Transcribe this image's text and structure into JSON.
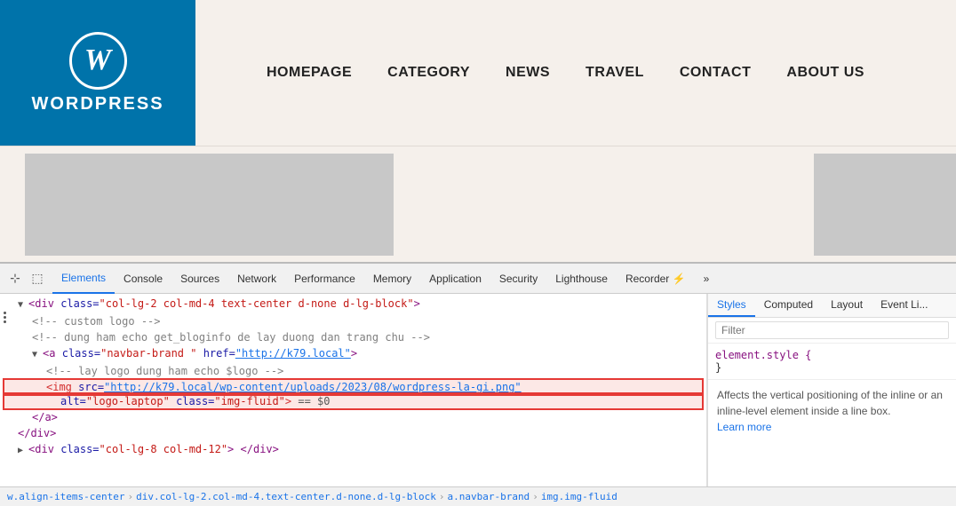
{
  "navbar": {
    "logo_text": "WORDPRESS",
    "links": [
      {
        "label": "HOMEPAGE",
        "id": "homepage"
      },
      {
        "label": "CATEGORY",
        "id": "category"
      },
      {
        "label": "NEWS",
        "id": "news"
      },
      {
        "label": "TRAVEL",
        "id": "travel"
      },
      {
        "label": "CONTACT",
        "id": "contact"
      },
      {
        "label": "ABOUT US",
        "id": "aboutus"
      }
    ]
  },
  "devtools": {
    "tabs": [
      {
        "label": "Elements",
        "active": true
      },
      {
        "label": "Console",
        "active": false
      },
      {
        "label": "Sources",
        "active": false
      },
      {
        "label": "Network",
        "active": false
      },
      {
        "label": "Performance",
        "active": false
      },
      {
        "label": "Memory",
        "active": false
      },
      {
        "label": "Application",
        "active": false
      },
      {
        "label": "Security",
        "active": false
      },
      {
        "label": "Lighthouse",
        "active": false
      },
      {
        "label": "Recorder ⚡",
        "active": false
      },
      {
        "label": "»",
        "active": false
      }
    ],
    "styles_tabs": [
      {
        "label": "Styles",
        "active": true
      },
      {
        "label": "Computed",
        "active": false
      },
      {
        "label": "Layout",
        "active": false
      },
      {
        "label": "Event Li...",
        "active": false
      }
    ],
    "filter_placeholder": "Filter",
    "element_style": "element.style {",
    "element_style_close": "}",
    "tooltip_text": "Affects the vertical positioning of the inline or an inline-level element inside a line box.",
    "learn_more_label": "Learn more"
  },
  "breadcrumb": {
    "items": [
      "w.align-items-center",
      "div.col-lg-2.col-md-4.text-center.d-none.d-lg-block",
      "a.navbar-brand",
      "img.img-fluid"
    ]
  },
  "code_lines": [
    {
      "indent": "indent1",
      "html": "▼ <span class='tag'>&lt;div</span> <span class='attr'>class=</span><span class='val'>\"col-lg-2 col-md-4 text-center d-none d-lg-block\"</span><span class='tag'>&gt;</span>"
    },
    {
      "indent": "indent2",
      "html": "<span class='comment'>&lt;!-- custom logo --&gt;</span>"
    },
    {
      "indent": "indent2",
      "html": "<span class='comment'>&lt;!-- dung ham echo get_bloginfo de lay duong dan trang chu --&gt;</span>"
    },
    {
      "indent": "indent2",
      "html": "<span class='arrow'>▼</span> <span class='tag'>&lt;a</span> <span class='attr'>class=</span><span class='val'>\"navbar-brand \"</span> <span class='attr'>href=</span><span class='link-val'>\"http://k79.local\"</span><span class='tag'>&gt;</span>"
    },
    {
      "indent": "indent3",
      "html": "<span class='comment'>&lt;!-- lay logo dung ham echo $logo --&gt;</span>"
    },
    {
      "indent": "indent3",
      "highlighted": true,
      "html": "<span class='tag'>&lt;img</span> <span class='attr'>src=</span><span class='link-val'>\"http://k79.local/wp-content/uploads/2023/08/wordpress-la-gi.png\"</span>"
    },
    {
      "indent": "indent4",
      "highlighted": true,
      "html": "<span class='attr'>alt=</span><span class='val'>\"logo-laptop\"</span> <span class='attr'>class=</span><span class='val'>\"img-fluid\"</span><span class='tag'>&gt;</span> <span class='equals'>== $0</span>"
    },
    {
      "indent": "indent2",
      "html": "<span class='tag'>&lt;/a&gt;</span>"
    },
    {
      "indent": "indent1",
      "html": "<span class='tag'>&lt;/div&gt;</span>"
    },
    {
      "indent": "indent1",
      "html": "<span class='arrow'>▶</span> <span class='tag'>&lt;div</span> <span class='attr'>class=</span><span class='val'>\"col-lg-8 col-md-12\"</span><span class='tag'>&gt;</span> <span class='tag'>&lt;/div&gt;</span>"
    }
  ]
}
